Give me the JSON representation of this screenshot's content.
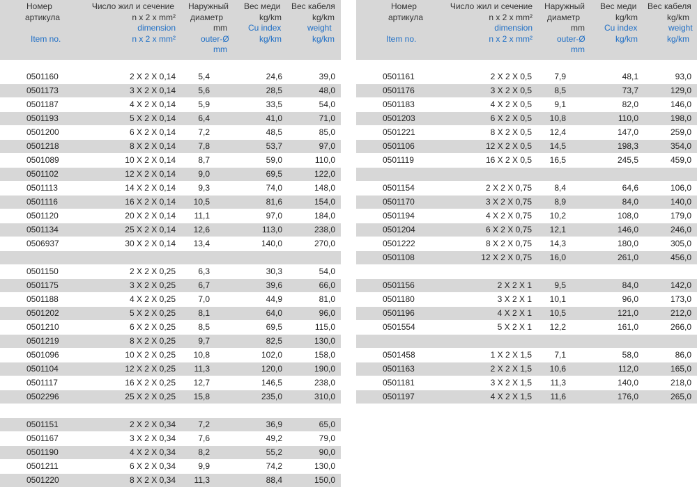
{
  "header": {
    "item_ru": [
      "Номер",
      "артикула"
    ],
    "item_en": "Item no.",
    "dim_ru": "Число жил и сечение",
    "dim_en": [
      "dimension",
      "n x 2 x mm²"
    ],
    "dim_unit": "n x 2 x mm²",
    "od_ru": [
      "Наружный",
      "диаметр"
    ],
    "od_unit": "mm",
    "od_en": "outer-Ø",
    "od_unit2": "mm",
    "cu_ru": "Вес меди",
    "cu_unit": "kg/km",
    "cu_en": "Cu index",
    "cu_unit2": "kg/km",
    "w_ru": "Вес кабеля",
    "w_unit": "kg/km",
    "w_en": "weight",
    "w_unit2": "kg/km"
  },
  "left_rows": [
    [
      "0501160",
      "2 X 2 X 0,14",
      "5,4",
      "24,6",
      "39,0"
    ],
    [
      "0501173",
      "3 X 2 X 0,14",
      "5,6",
      "28,5",
      "48,0"
    ],
    [
      "0501187",
      "4 X 2 X 0,14",
      "5,9",
      "33,5",
      "54,0"
    ],
    [
      "0501193",
      "5 X 2 X 0,14",
      "6,4",
      "41,0",
      "71,0"
    ],
    [
      "0501200",
      "6 X 2 X 0,14",
      "7,2",
      "48,5",
      "85,0"
    ],
    [
      "0501218",
      "8 X 2 X 0,14",
      "7,8",
      "53,7",
      "97,0"
    ],
    [
      "0501089",
      "10 X 2 X 0,14",
      "8,7",
      "59,0",
      "110,0"
    ],
    [
      "0501102",
      "12 X 2 X 0,14",
      "9,0",
      "69,5",
      "122,0"
    ],
    [
      "0501113",
      "14 X 2 X 0,14",
      "9,3",
      "74,0",
      "148,0"
    ],
    [
      "0501116",
      "16 X 2 X 0,14",
      "10,5",
      "81,6",
      "154,0"
    ],
    [
      "0501120",
      "20 X 2 X 0,14",
      "11,1",
      "97,0",
      "184,0"
    ],
    [
      "0501134",
      "25 X 2 X 0,14",
      "12,6",
      "113,0",
      "238,0"
    ],
    [
      "0506937",
      "30 X 2 X 0,14",
      "13,4",
      "140,0",
      "270,0"
    ],
    [
      "",
      "",
      "",
      "",
      ""
    ],
    [
      "0501150",
      "2 X 2 X 0,25",
      "6,3",
      "30,3",
      "54,0"
    ],
    [
      "0501175",
      "3 X 2 X 0,25",
      "6,7",
      "39,6",
      "66,0"
    ],
    [
      "0501188",
      "4 X 2 X 0,25",
      "7,0",
      "44,9",
      "81,0"
    ],
    [
      "0501202",
      "5 X 2 X 0,25",
      "8,1",
      "64,0",
      "96,0"
    ],
    [
      "0501210",
      "6 X 2 X 0,25",
      "8,5",
      "69,5",
      "115,0"
    ],
    [
      "0501219",
      "8 X 2 X 0,25",
      "9,7",
      "82,5",
      "130,0"
    ],
    [
      "0501096",
      "10 X 2 X 0,25",
      "10,8",
      "102,0",
      "158,0"
    ],
    [
      "0501104",
      "12 X 2 X 0,25",
      "11,3",
      "120,0",
      "190,0"
    ],
    [
      "0501117",
      "16 X 2 X 0,25",
      "12,7",
      "146,5",
      "238,0"
    ],
    [
      "0502296",
      "25 X 2 X 0,25",
      "15,8",
      "235,0",
      "310,0"
    ],
    [
      "",
      "",
      "",
      "",
      ""
    ],
    [
      "0501151",
      "2 X 2 X 0,34",
      "7,2",
      "36,9",
      "65,0"
    ],
    [
      "0501167",
      "3 X 2 X 0,34",
      "7,6",
      "49,2",
      "79,0"
    ],
    [
      "0501190",
      "4 X 2 X 0,34",
      "8,2",
      "55,2",
      "90,0"
    ],
    [
      "0501211",
      "6 X 2 X 0,34",
      "9,9",
      "74,2",
      "130,0"
    ],
    [
      "0501220",
      "8 X 2 X 0,34",
      "11,3",
      "88,4",
      "150,0"
    ]
  ],
  "right_rows": [
    [
      "0501161",
      "2 X 2 X 0,5",
      "7,9",
      "48,1",
      "93,0"
    ],
    [
      "0501176",
      "3 X 2 X 0,5",
      "8,5",
      "73,7",
      "129,0"
    ],
    [
      "0501183",
      "4 X 2 X 0,5",
      "9,1",
      "82,0",
      "146,0"
    ],
    [
      "0501203",
      "6 X 2 X 0,5",
      "10,8",
      "110,0",
      "198,0"
    ],
    [
      "0501221",
      "8 X 2 X 0,5",
      "12,4",
      "147,0",
      "259,0"
    ],
    [
      "0501106",
      "12 X 2 X 0,5",
      "14,5",
      "198,3",
      "354,0"
    ],
    [
      "0501119",
      "16 X 2 X 0,5",
      "16,5",
      "245,5",
      "459,0"
    ],
    [
      "",
      "",
      "",
      "",
      ""
    ],
    [
      "0501154",
      "2 X 2 X 0,75",
      "8,4",
      "64,6",
      "106,0"
    ],
    [
      "0501170",
      "3 X 2 X 0,75",
      "8,9",
      "84,0",
      "140,0"
    ],
    [
      "0501194",
      "4 X 2 X 0,75",
      "10,2",
      "108,0",
      "179,0"
    ],
    [
      "0501204",
      "6 X 2 X 0,75",
      "12,1",
      "146,0",
      "246,0"
    ],
    [
      "0501222",
      "8 X 2 X 0,75",
      "14,3",
      "180,0",
      "305,0"
    ],
    [
      "0501108",
      "12 X 2 X 0,75",
      "16,0",
      "261,0",
      "456,0"
    ],
    [
      "",
      "",
      "",
      "",
      ""
    ],
    [
      "0501156",
      "2 X 2 X 1",
      "9,5",
      "84,0",
      "142,0"
    ],
    [
      "0501180",
      "3 X 2 X 1",
      "10,1",
      "96,0",
      "173,0"
    ],
    [
      "0501196",
      "4 X 2 X 1",
      "10,5",
      "121,0",
      "212,0"
    ],
    [
      "0501554",
      "5 X 2 X 1",
      "12,2",
      "161,0",
      "266,0"
    ],
    [
      "",
      "",
      "",
      "",
      ""
    ],
    [
      "0501458",
      "1 X 2 X 1,5",
      "7,1",
      "58,0",
      "86,0"
    ],
    [
      "0501163",
      "2 X 2 X 1,5",
      "10,6",
      "112,0",
      "165,0"
    ],
    [
      "0501181",
      "3 X 2 X 1,5",
      "11,3",
      "140,0",
      "218,0"
    ],
    [
      "0501197",
      "4 X 2 X 1,5",
      "11,6",
      "176,0",
      "265,0"
    ]
  ]
}
